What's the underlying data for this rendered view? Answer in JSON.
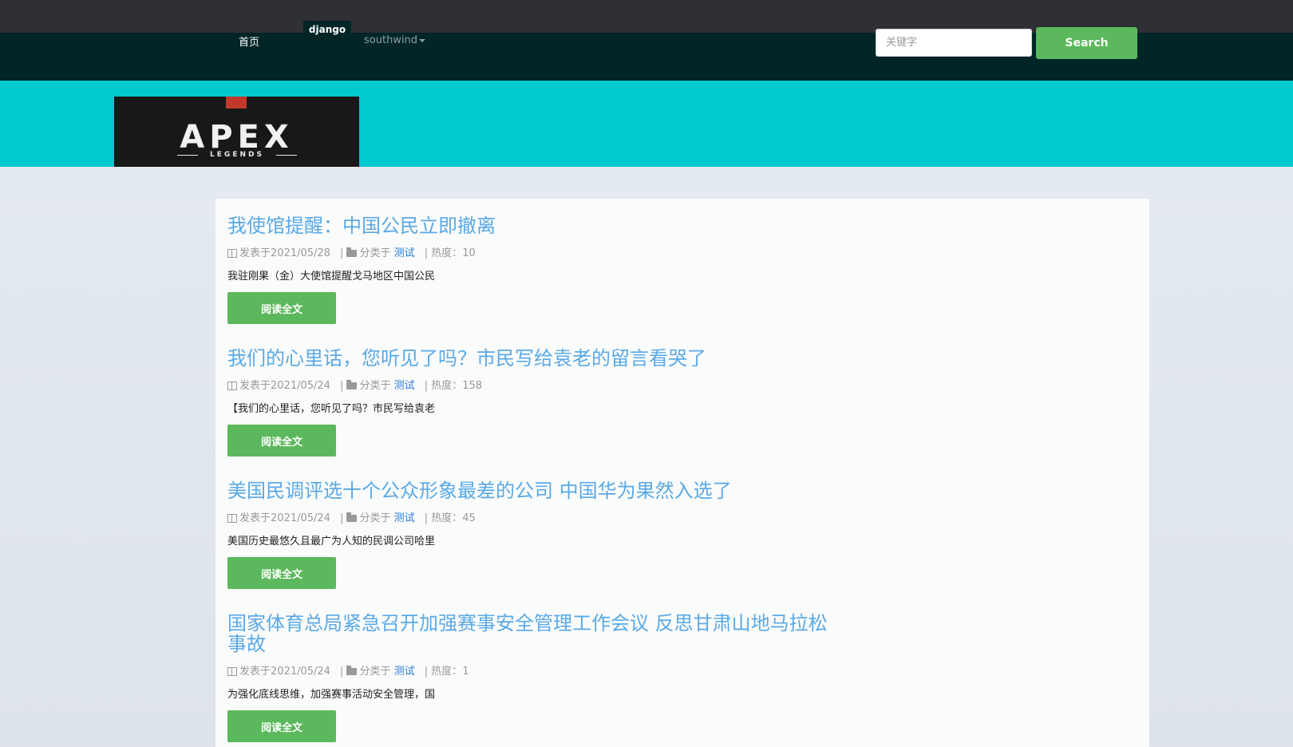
{
  "nav": {
    "home": "首页",
    "brand": "django",
    "user": "southwind",
    "search_placeholder": "关键字",
    "search_button": "Search"
  },
  "logo": {
    "title": "APEX",
    "subtitle": "LEGENDS"
  },
  "colors": {
    "topstrip": "#2f3033",
    "navbar": "#022526",
    "banner": "#00cacc",
    "accent_green": "#5cb85c",
    "title_blue": "#5aa9e6"
  },
  "articles": [
    {
      "title": "我使馆提醒：中国公民立即撤离",
      "published": "发表于2021/05/28",
      "category_label": "分类于",
      "category": "测试",
      "heat_label": "热度：",
      "heat": "10",
      "excerpt": "我驻刚果（金）大使馆提醒戈马地区中国公民",
      "read_more": "阅读全文"
    },
    {
      "title": "我们的心里话，您听见了吗？市民写给袁老的留言看哭了",
      "published": "发表于2021/05/24",
      "category_label": "分类于",
      "category": "测试",
      "heat_label": "热度：",
      "heat": "158",
      "excerpt": "【我们的心里话，您听见了吗？市民写给袁老",
      "read_more": "阅读全文"
    },
    {
      "title": "美国民调评选十个公众形象最差的公司 中国华为果然入选了",
      "published": "发表于2021/05/24",
      "category_label": "分类于",
      "category": "测试",
      "heat_label": "热度：",
      "heat": "45",
      "excerpt": "美国历史最悠久且最广为人知的民调公司哈里",
      "read_more": "阅读全文"
    },
    {
      "title": "国家体育总局紧急召开加强赛事安全管理工作会议 反思甘肃山地马拉松事故",
      "published": "发表于2021/05/24",
      "category_label": "分类于",
      "category": "测试",
      "heat_label": "热度：",
      "heat": "1",
      "excerpt": "为强化底线思维，加强赛事活动安全管理，国",
      "read_more": "阅读全文"
    }
  ]
}
